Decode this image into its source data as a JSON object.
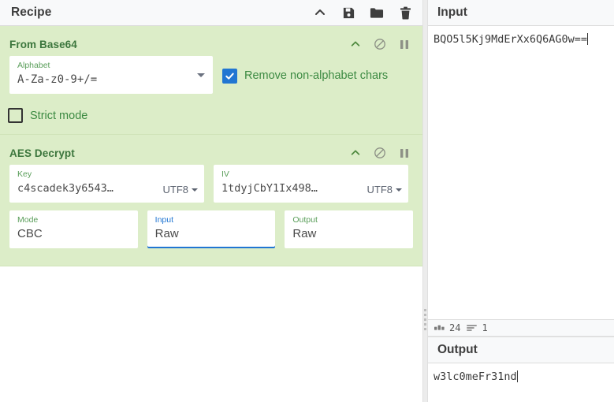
{
  "recipe": {
    "title": "Recipe",
    "header_icons": [
      {
        "name": "collapse-chevron-icon",
        "label": "Collapse"
      },
      {
        "name": "save-icon",
        "label": "Save recipe"
      },
      {
        "name": "folder-icon",
        "label": "Load recipe"
      },
      {
        "name": "trash-icon",
        "label": "Clear recipe"
      }
    ],
    "operations": [
      {
        "title": "From Base64",
        "icons": [
          {
            "name": "collapse-chevron-icon"
          },
          {
            "name": "disable-icon"
          },
          {
            "name": "breakpoint-pause-icon"
          }
        ],
        "args": {
          "alphabet_label": "Alphabet",
          "alphabet_value": "A-Za-z0-9+/=",
          "remove_nonalphabet_label": "Remove non-alphabet chars",
          "remove_nonalphabet_checked": true,
          "strict_mode_label": "Strict mode",
          "strict_mode_checked": false
        }
      },
      {
        "title": "AES Decrypt",
        "icons": [
          {
            "name": "collapse-chevron-icon"
          },
          {
            "name": "disable-icon"
          },
          {
            "name": "breakpoint-pause-icon"
          }
        ],
        "args": {
          "key_label": "Key",
          "key_value": "c4scadek3y6543…",
          "key_encoding": "UTF8",
          "iv_label": "IV",
          "iv_value": "1tdyjCbY1Ix498…",
          "iv_encoding": "UTF8",
          "mode_label": "Mode",
          "mode_value": "CBC",
          "input_label": "Input",
          "input_value": "Raw",
          "output_label": "Output",
          "output_value": "Raw"
        }
      }
    ]
  },
  "io": {
    "input": {
      "title": "Input",
      "value": "BQO5l5Kj9MdErXx6Q6AG0w=="
    },
    "status": {
      "length_icon": "abc-icon",
      "length": "24",
      "lines_icon": "lines-icon",
      "lines": "1"
    },
    "output": {
      "title": "Output",
      "value": "w3lc0meFr31nd"
    }
  },
  "colors": {
    "operation_bg": "#dcedc8",
    "operation_title": "#3c763d",
    "checkbox_on": "#2176d2",
    "focus_blue": "#2176d2",
    "panel_header_bg": "#f8f9fa"
  }
}
